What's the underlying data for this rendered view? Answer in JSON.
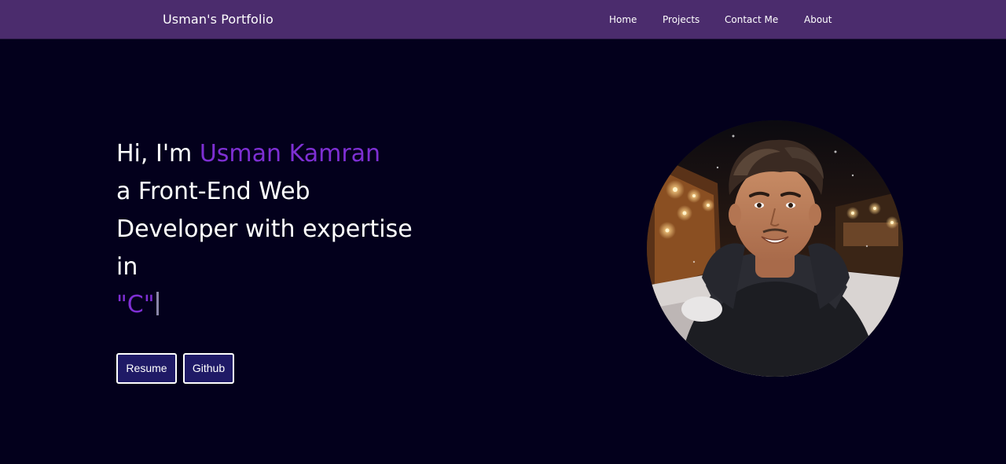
{
  "navbar": {
    "brand": "Usman's Portfolio",
    "links": [
      {
        "label": "Home"
      },
      {
        "label": "Projects"
      },
      {
        "label": "Contact Me"
      },
      {
        "label": "About"
      }
    ]
  },
  "hero": {
    "greeting": "Hi, I'm",
    "name": "Usman Kamran",
    "line2": "a Front-End Web",
    "line3": "Developer with expertise",
    "line4": "in",
    "typed_text": "\"C\""
  },
  "buttons": {
    "resume": "Resume",
    "github": "Github"
  },
  "colors": {
    "background": "#03001c",
    "navbar": "#4b2c6d",
    "accent": "#7e2fd3",
    "button_bg": "#1f1a66"
  }
}
